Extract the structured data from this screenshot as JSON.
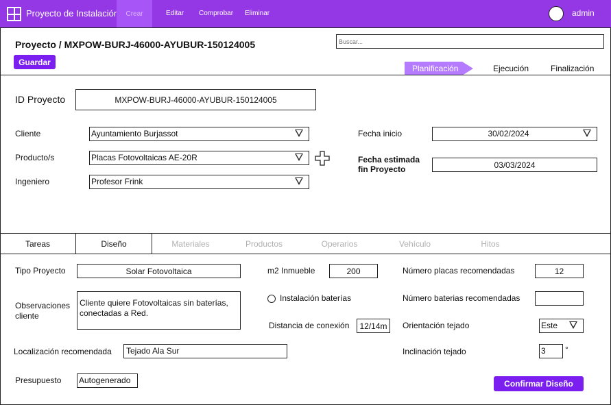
{
  "nav": {
    "app_title": "Proyecto de Instalación",
    "crear": "Crear",
    "editar": "Editar",
    "comprobar": "Comprobar",
    "eliminar": "Eliminar",
    "user": "admin",
    "colors": {
      "bar": "#9438e6",
      "active": "#a855f7"
    }
  },
  "header": {
    "title": "Proyecto / MXPOW-BURJ-46000-AYUBUR-150124005",
    "save_label": "Guardar",
    "search_placeholder": "Buscar..."
  },
  "stages": [
    "Planificación",
    "Ejecución",
    "Finalización"
  ],
  "form": {
    "id_label": "ID Proyecto",
    "id_value": "MXPOW-BURJ-46000-AYUBUR-150124005",
    "cliente_label": "Cliente",
    "cliente_value": "Ayuntamiento Burjassot",
    "producto_label": "Producto/s",
    "producto_value": "Placas Fotovoltaicas AE-20R",
    "ingeniero_label": "Ingeniero",
    "ingeniero_value": "Profesor Frink",
    "fecha_inicio_label": "Fecha inicio",
    "fecha_inicio_value": "30/02/2024",
    "fecha_fin_label_1": "Fecha estimada",
    "fecha_fin_label_2": "fin Proyecto",
    "fecha_fin_value": "03/03/2024"
  },
  "tabs": [
    "Tareas",
    "Diseño",
    "Materiales",
    "Productos",
    "Operarios",
    "Vehículo",
    "Hitos"
  ],
  "design": {
    "tipo_label": "Tipo Proyecto",
    "tipo_value": "Solar Fotovoltaica",
    "m2_label": "m2 Inmueble",
    "m2_value": "200",
    "num_placas_label": "Número placas recomendadas",
    "num_placas_value": "12",
    "obs_label_1": "Observaciones",
    "obs_label_2": "cliente",
    "obs_value_1": "Cliente quiere Fotovoltaicas sin baterías,",
    "obs_value_2": "conectadas a Red.",
    "baterias_label": "Instalación baterías",
    "num_baterias_label": "Número baterias recomendadas",
    "num_baterias_value": "",
    "distancia_label": "Distancia de conexión",
    "distancia_value": "12/14m",
    "orientacion_label": "Orientación tejado",
    "orientacion_value": "Este",
    "localizacion_label": "Localización recomendada",
    "localizacion_value": "Tejado Ala Sur",
    "inclinacion_label": "Inclinación tejado",
    "inclinacion_value": "3",
    "inclinacion_unit": "°",
    "presupuesto_label": "Presupuesto",
    "presupuesto_value": "Autogenerado",
    "confirm_label": "Confirmar Diseño"
  }
}
